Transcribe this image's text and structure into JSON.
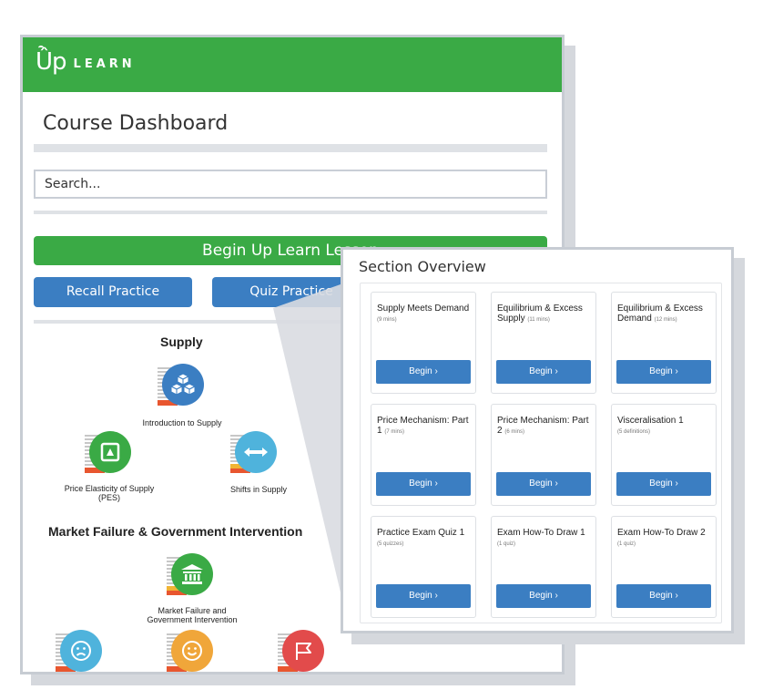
{
  "header": {
    "logo_mark": "Ûp",
    "logo_word": "LEARN",
    "brand_color": "#3aaa45"
  },
  "dashboard": {
    "title": "Course Dashboard",
    "search_placeholder": "Search...",
    "begin_lesson_label": "Begin Up Learn Lesson",
    "recall_label": "Recall Practice",
    "quiz_label": "Quiz Practice",
    "accent_color": "#3b7ec2"
  },
  "sections": {
    "supply": {
      "heading": "Supply",
      "intro_label": "Introduction to Supply",
      "pes_label_1": "Price Elasticity of Supply",
      "pes_label_2": "(PES)",
      "shifts_label": "Shifts in Supply",
      "icons": {
        "intro": "cubes-icon",
        "pes": "square-in-square-icon",
        "shifts": "double-arrow-icon"
      }
    },
    "market_failure": {
      "heading": "Market Failure & Government Intervention",
      "node_label_1": "Market Failure and",
      "node_label_2": "Government Intervention",
      "icons": {
        "main": "government-building-icon",
        "row": [
          "sad-face-icon",
          "smiley-face-icon",
          "flag-icon"
        ]
      }
    }
  },
  "overview": {
    "title": "Section Overview",
    "cards": [
      {
        "title": "Supply Meets Demand",
        "meta": "(9 mins)",
        "button": "Begin  ›"
      },
      {
        "title": "Equilibrium & Excess Supply",
        "meta": "(11 mins)",
        "button": "Begin  ›"
      },
      {
        "title": "Equilibrium & Excess Demand",
        "meta": "(12 mins)",
        "button": "Begin  ›"
      },
      {
        "title": "Price Mechanism: Part 1",
        "meta": "(7 mins)",
        "button": "Begin  ›"
      },
      {
        "title": "Price Mechanism: Part 2",
        "meta": "(6 mins)",
        "button": "Begin  ›"
      },
      {
        "title": "Visceralisation 1",
        "meta": "(5 definitions)",
        "button": "Begin  ›"
      },
      {
        "title": "Practice Exam Quiz 1",
        "meta": "(5 quizzes)",
        "button": "Begin  ›"
      },
      {
        "title": "Exam How-To Draw 1",
        "meta": "(1 quiz)",
        "button": "Begin  ›"
      },
      {
        "title": "Exam How-To Draw 2",
        "meta": "(1 quiz)",
        "button": "Begin  ›"
      }
    ]
  }
}
